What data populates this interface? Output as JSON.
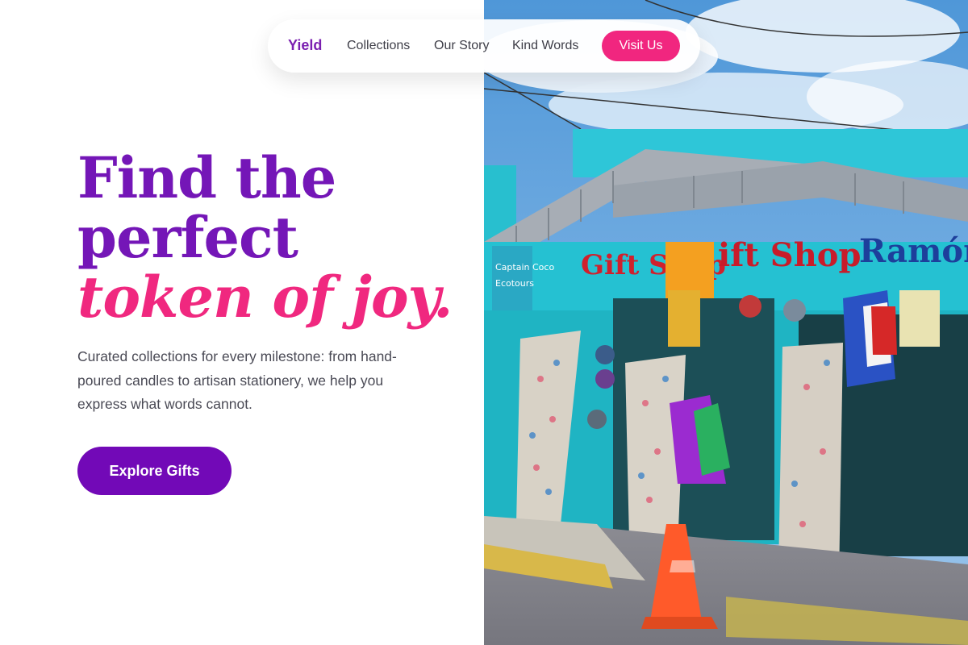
{
  "nav": {
    "brand": "Yield",
    "links": [
      "Collections",
      "Our Story",
      "Kind Words"
    ],
    "cta": "Visit Us"
  },
  "hero": {
    "headline_line1": "Find the",
    "headline_line2": "perfect",
    "headline_accent": "token of joy.",
    "subtext": "Curated collections for every milestone: from hand-poured candles to artisan stationery, we help you express what words cannot.",
    "button": "Explore Gifts"
  },
  "image": {
    "subject": "turquoise roadside gift shop storefront",
    "signs": [
      "Gift Shop",
      "Ramón",
      "Captain Coco Ecotours"
    ]
  },
  "colors": {
    "brand_purple": "#7416b7",
    "accent_pink": "#f0287f",
    "button_purple": "#7209b7",
    "cta_pink": "#f1267f"
  }
}
